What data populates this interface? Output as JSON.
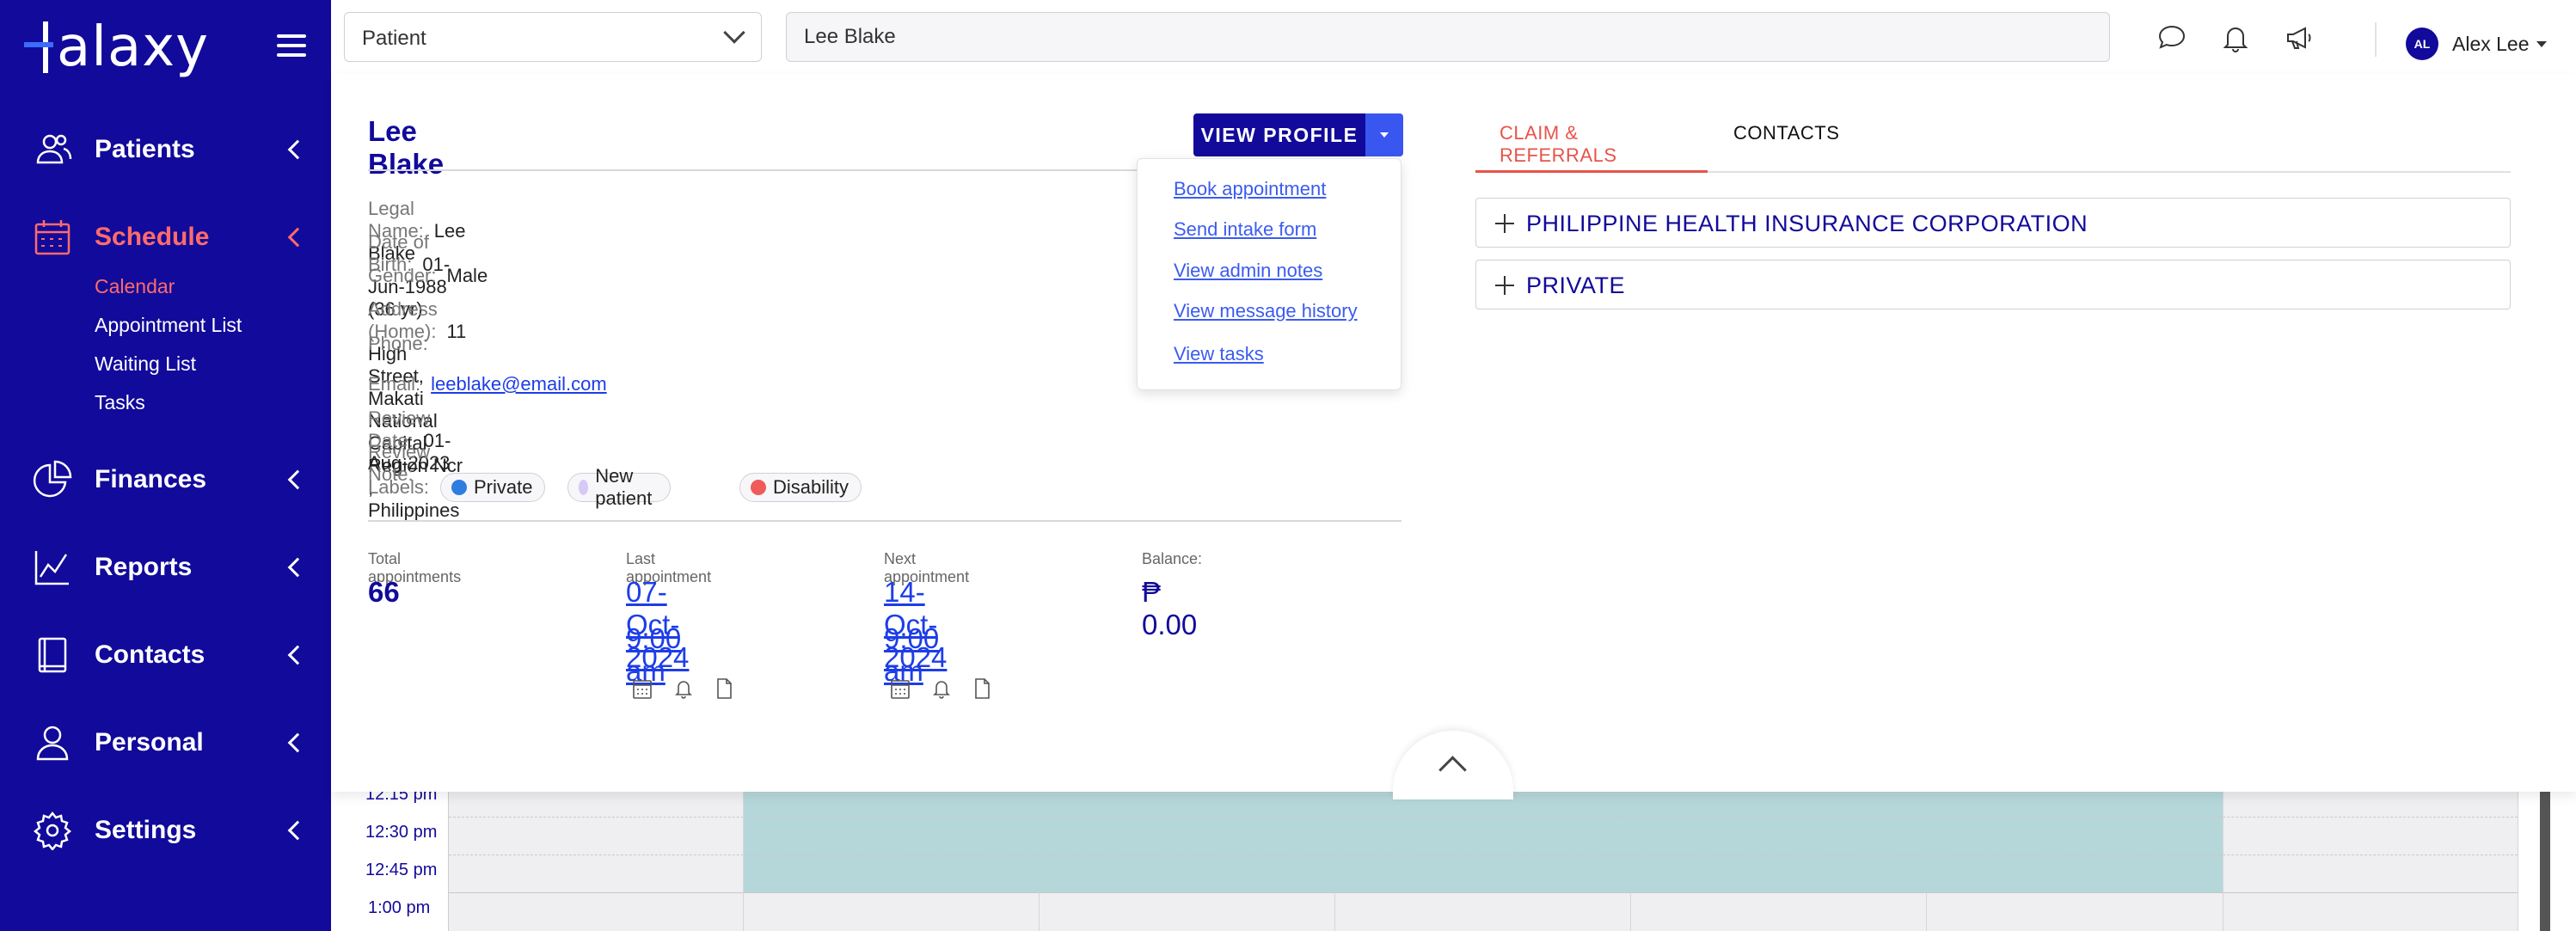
{
  "brand": {
    "name": "Halaxy",
    "logo_suffix": "alaxy"
  },
  "sidebar": {
    "items": [
      {
        "label": "Patients",
        "icon": "users-icon"
      },
      {
        "label": "Schedule",
        "icon": "calendar-icon",
        "active": true,
        "subitems": [
          {
            "label": "Calendar",
            "active": true
          },
          {
            "label": "Appointment List"
          },
          {
            "label": "Waiting List"
          },
          {
            "label": "Tasks"
          }
        ]
      },
      {
        "label": "Finances",
        "icon": "pie-chart-icon"
      },
      {
        "label": "Reports",
        "icon": "line-chart-icon"
      },
      {
        "label": "Contacts",
        "icon": "book-icon"
      },
      {
        "label": "Personal",
        "icon": "person-icon"
      },
      {
        "label": "Settings",
        "icon": "gear-icon"
      }
    ]
  },
  "topbar": {
    "search_type": "Patient",
    "search_value": "Lee Blake",
    "user": {
      "initials": "AL",
      "name": "Alex Lee"
    }
  },
  "patient": {
    "name": "Lee Blake",
    "fields": {
      "legal_name_label": "Legal Name:",
      "legal_name": "Lee Blake",
      "dob_label": "Date of Birth:",
      "dob": "01-Jun-1988 (36 yr)",
      "gender_label": "Gender:",
      "gender": "Male",
      "address_label": "Address (Home):",
      "address": "11 High Street, Makati National Capital Region Ncr , Philippines",
      "phone_label": "Phone:",
      "phone": "",
      "email_label": "Email:",
      "email": "leeblake@email.com",
      "review_date_label": "Review Date:",
      "review_date": "01-Aug-2023",
      "review_note_label": "Review Note:",
      "review_note": "",
      "labels_label": "Labels:"
    },
    "labels": [
      {
        "text": "Private",
        "color": "#2f7de1"
      },
      {
        "text": "New patient",
        "color": "#d7c9f5"
      },
      {
        "text": "Disability",
        "color": "#ef5b5b"
      }
    ],
    "stats": {
      "total_label": "Total appointments",
      "total": "66",
      "last_label": "Last appointment",
      "last_date": "07-Oct-2024",
      "last_time": "9:00 am",
      "next_label": "Next appointment",
      "next_date": "14-Oct-2024",
      "next_time": "9:00 am",
      "balance_label": "Balance:",
      "balance": "₱ 0.00"
    }
  },
  "view_profile": {
    "label": "VIEW PROFILE",
    "menu": [
      "Book appointment",
      "Send intake form",
      "View admin notes",
      "View message history",
      "View tasks"
    ]
  },
  "tabs": [
    {
      "label": "CLAIM & REFERRALS",
      "active": true
    },
    {
      "label": "CONTACTS",
      "active": false
    }
  ],
  "accordions": [
    "PHILIPPINE HEALTH INSURANCE CORPORATION",
    "PRIVATE"
  ],
  "calendar": {
    "times": [
      "12:15 pm",
      "12:30 pm",
      "12:45 pm",
      "1:00 pm"
    ],
    "appointment_color": "#b6d7da"
  },
  "colors": {
    "sidebar": "#120a9a",
    "accent": "#e8534a",
    "link": "#1d3de8"
  }
}
